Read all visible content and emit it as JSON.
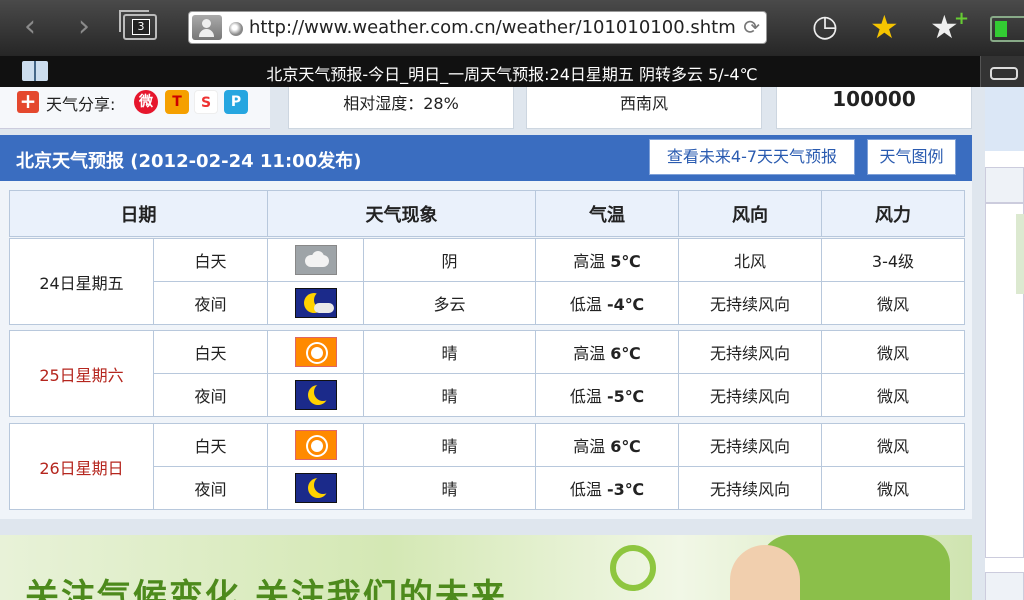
{
  "browser": {
    "url": "http://www.weather.com.cn/weather/101010100.shtm",
    "tab_count": "3",
    "page_title": "北京天气预报-今日_明日_一周天气预报:24日星期五 阴转多云 5/-4℃"
  },
  "top_strip": {
    "share_label": "天气分享:",
    "humidity": "相对湿度：28%",
    "wind": "西南风",
    "number": "100000"
  },
  "forecast": {
    "title": "北京天气预报 (2012-02-24  11:00发布)",
    "btn_future": "查看未来4-7天天气预报",
    "btn_legend": "天气图例",
    "headers": [
      "日期",
      "天气现象",
      "气温",
      "风向",
      "风力"
    ],
    "days": [
      {
        "date": "24日星期五",
        "day": {
          "period": "白天",
          "icon": "cloud-icon",
          "weather": "阴",
          "temp_label": "高温",
          "temp": "5℃",
          "wind_dir": "北风",
          "wind_force": "3-4级"
        },
        "night": {
          "period": "夜间",
          "icon": "moon-cloud-icon",
          "weather": "多云",
          "temp_label": "低温",
          "temp": "-4℃",
          "wind_dir": "无持续风向",
          "wind_force": "微风"
        }
      },
      {
        "date": "25日星期六",
        "day": {
          "period": "白天",
          "icon": "sun-icon",
          "weather": "晴",
          "temp_label": "高温",
          "temp": "6℃",
          "wind_dir": "无持续风向",
          "wind_force": "微风"
        },
        "night": {
          "period": "夜间",
          "icon": "moon-icon",
          "weather": "晴",
          "temp_label": "低温",
          "temp": "-5℃",
          "wind_dir": "无持续风向",
          "wind_force": "微风"
        }
      },
      {
        "date": "26日星期日",
        "day": {
          "period": "白天",
          "icon": "sun-icon",
          "weather": "晴",
          "temp_label": "高温",
          "temp": "6℃",
          "wind_dir": "无持续风向",
          "wind_force": "微风"
        },
        "night": {
          "period": "夜间",
          "icon": "moon-icon",
          "weather": "晴",
          "temp_label": "低温",
          "temp": "-3℃",
          "wind_dir": "无持续风向",
          "wind_force": "微风"
        }
      }
    ]
  },
  "banner": {
    "text": "关注气候变化  关注我们的未来"
  },
  "colors": {
    "header_blue": "#3a6dc0",
    "high_temp": "#d55a10",
    "low_temp": "#1e2e76",
    "weekend_date": "#b5261e"
  }
}
